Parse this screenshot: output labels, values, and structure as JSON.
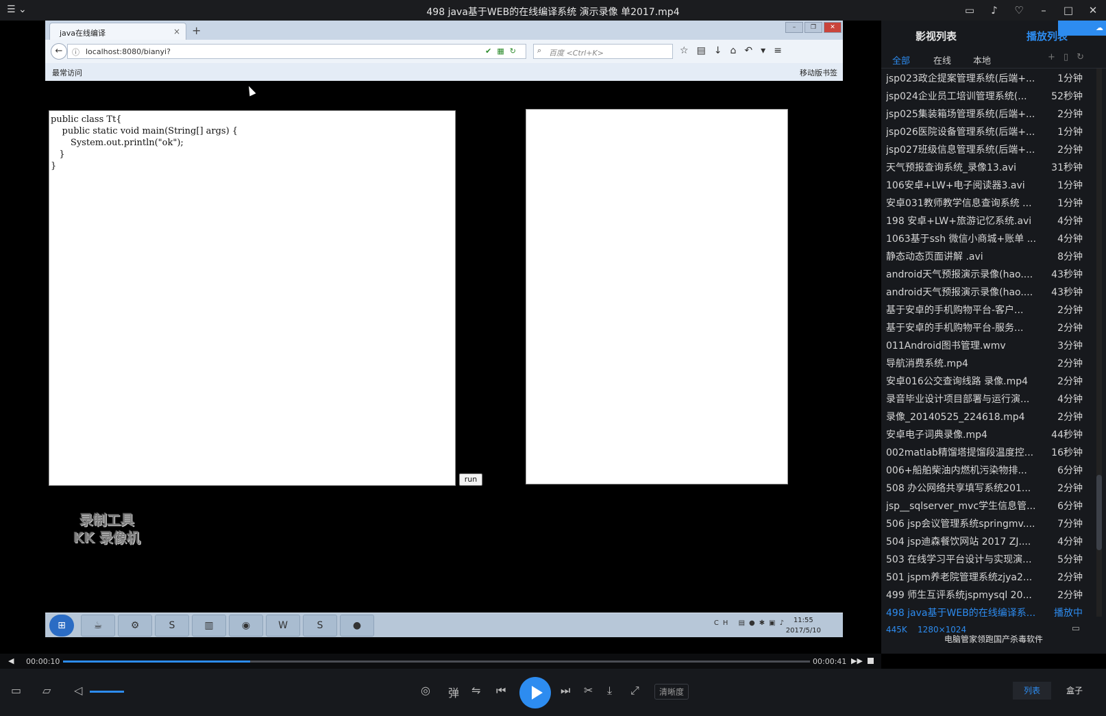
{
  "window": {
    "title": "498 java基于WEB的在线编译系统 演示录像 单2017.mp4"
  },
  "browser": {
    "tab_title": "java在线编译",
    "tab_close": "×",
    "new_tab": "+",
    "url": "localhost:8080/bianyi?",
    "search_placeholder": "百度 <Ctrl+K>",
    "bookmark_left": "最常访问",
    "bookmark_right": "移动版书签"
  },
  "editor": {
    "code": "public class Tt{\n    public static void main(String[] args) {\n       System.out.println(\"ok\");\n   }\n}",
    "run_label": "run"
  },
  "watermark": {
    "line1": "录制工具",
    "line2": "KK 录像机"
  },
  "taskbar": {
    "tray_text": "CH",
    "time": "11:55",
    "date": "2017/5/10"
  },
  "sidebar": {
    "tab_media": "影视列表",
    "tab_playlist": "播放列表",
    "filters": [
      "全部",
      "在线",
      "本地"
    ],
    "items": [
      {
        "name": "jsp023政企提案管理系统(后端+...",
        "duration": "1分钟"
      },
      {
        "name": "jsp024企业员工培训管理系统(...",
        "duration": "52秒钟"
      },
      {
        "name": "jsp025集装箱场管理系统(后端+...",
        "duration": "2分钟"
      },
      {
        "name": "jsp026医院设备管理系统(后端+...",
        "duration": "1分钟"
      },
      {
        "name": "jsp027班级信息管理系统(后端+...",
        "duration": "2分钟"
      },
      {
        "name": "天气预报查询系统_录像13.avi",
        "duration": "31秒钟"
      },
      {
        "name": "106安卓+LW+电子阅读器3.avi",
        "duration": "1分钟"
      },
      {
        "name": "安卓031教师教学信息查询系统 ...",
        "duration": "1分钟"
      },
      {
        "name": "198 安卓+LW+旅游记忆系统.avi",
        "duration": "4分钟"
      },
      {
        "name": "1063基于ssh 微信小商城+账单 ...",
        "duration": "4分钟"
      },
      {
        "name": "静态动态页面讲解 .avi",
        "duration": "8分钟"
      },
      {
        "name": "android天气预报演示录像(hao....",
        "duration": "43秒钟"
      },
      {
        "name": "android天气预报演示录像(hao....",
        "duration": "43秒钟"
      },
      {
        "name": "基于安卓的手机购物平台-客户...",
        "duration": "2分钟"
      },
      {
        "name": "基于安卓的手机购物平台-服务...",
        "duration": "2分钟"
      },
      {
        "name": "011Android图书管理.wmv",
        "duration": "3分钟"
      },
      {
        "name": "导航消费系统.mp4",
        "duration": "2分钟"
      },
      {
        "name": "安卓016公交查询线路 录像.mp4",
        "duration": "2分钟"
      },
      {
        "name": "录音毕业设计项目部署与运行演...",
        "duration": "4分钟"
      },
      {
        "name": "录像_20140525_224618.mp4",
        "duration": "2分钟"
      },
      {
        "name": "安卓电子词典录像.mp4",
        "duration": "44秒钟"
      },
      {
        "name": "002matlab精馏塔提馏段温度控...",
        "duration": "16秒钟"
      },
      {
        "name": "006+船舶柴油内燃机污染物排...",
        "duration": "6分钟"
      },
      {
        "name": "508 办公网络共享填写系统201...",
        "duration": "2分钟"
      },
      {
        "name": "jsp__sqlserver_mvc学生信息管...",
        "duration": "6分钟"
      },
      {
        "name": "506 jsp会议管理系统springmv....",
        "duration": "7分钟"
      },
      {
        "name": "504 jsp迪森餐饮网站 2017 ZJ....",
        "duration": "4分钟"
      },
      {
        "name": "503 在线学习平台设计与实现演...",
        "duration": "5分钟"
      },
      {
        "name": "501 jspm养老院管理系统zjya2...",
        "duration": "2分钟"
      },
      {
        "name": "499 师生互评系统jspmysql 20...",
        "duration": "2分钟"
      }
    ],
    "active": {
      "name": "498 java基于WEB的在线编译系...",
      "status": "播放中"
    },
    "active_meta_size": "445K",
    "active_meta_res": "1280×1024",
    "news": "电脑管家领跑国产杀毒软件",
    "scroll_position": 0.86
  },
  "player": {
    "current_time": "00:00:10",
    "total_time": "00:00:41",
    "progress": 0.25,
    "volume": 0.5,
    "danmaku_label": "弹",
    "quality_label": "清晰度",
    "btn_list": "列表",
    "btn_box": "盒子"
  }
}
